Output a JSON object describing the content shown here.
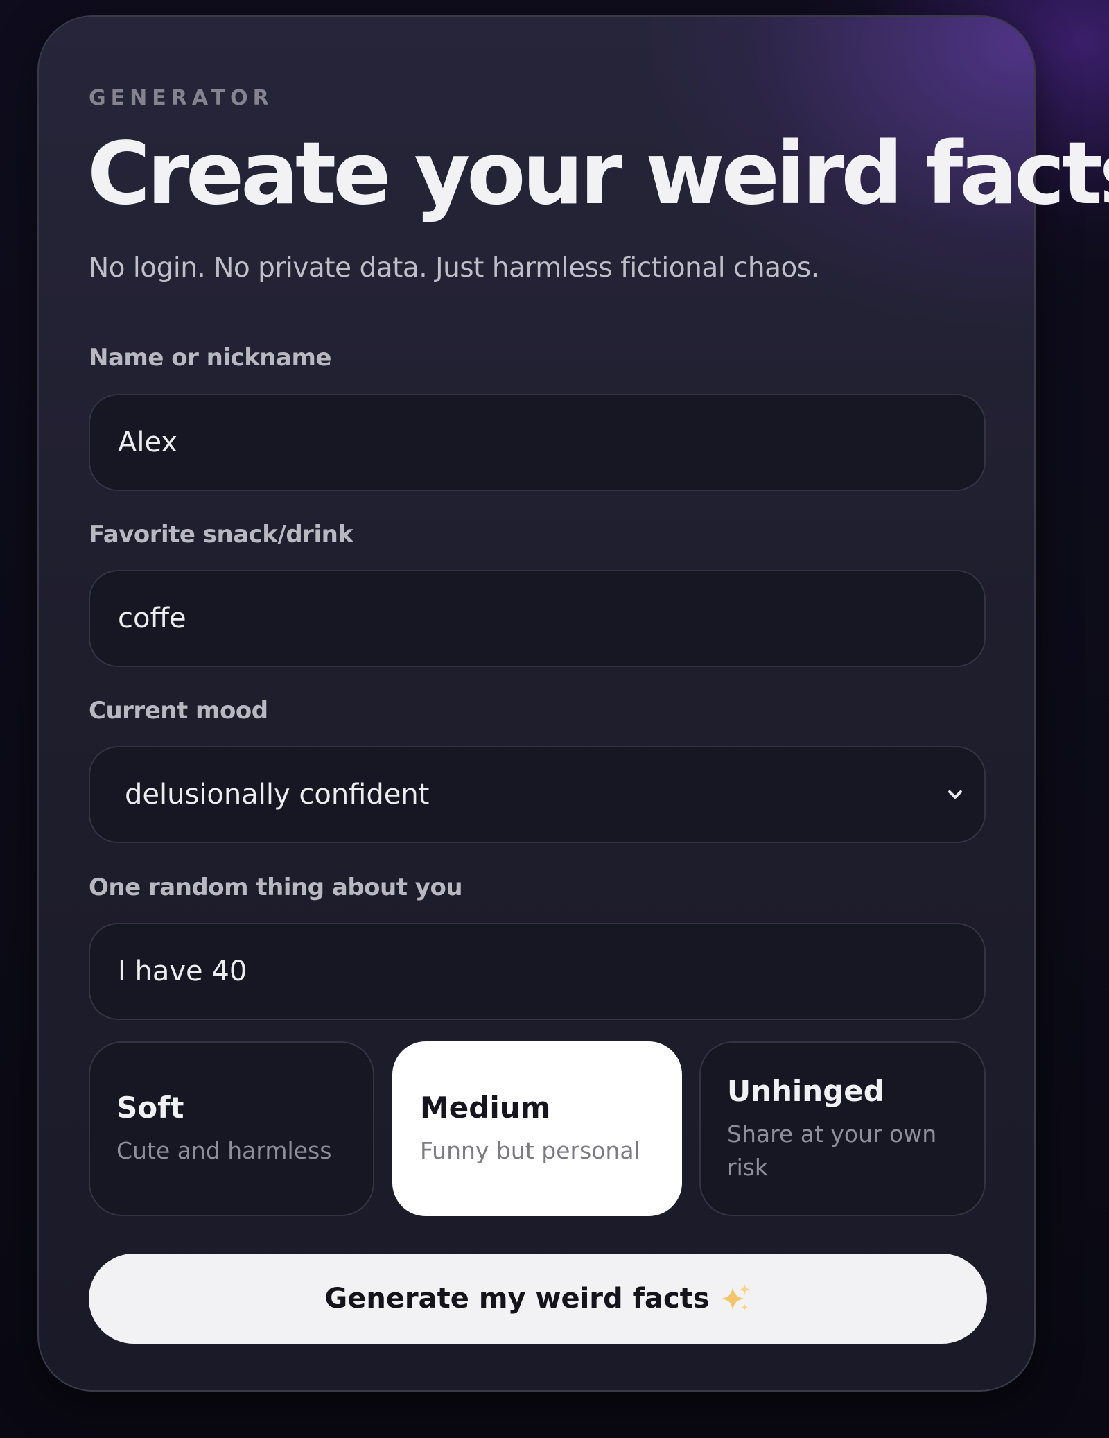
{
  "header": {
    "eyebrow": "GENERATOR",
    "title": "Create your weird facts",
    "subtitle": "No login. No private data. Just harmless fictional chaos."
  },
  "form": {
    "name": {
      "label": "Name or nickname",
      "value": "Alex"
    },
    "snack": {
      "label": "Favorite snack/drink",
      "value": "coffe"
    },
    "mood": {
      "label": "Current mood",
      "value": "delusionally confident"
    },
    "random": {
      "label": "One random thing about you",
      "value": "I have 40"
    }
  },
  "tones": [
    {
      "name": "Soft",
      "desc": "Cute and harmless",
      "selected": false
    },
    {
      "name": "Medium",
      "desc": "Funny but personal",
      "selected": true
    },
    {
      "name": "Unhinged",
      "desc": "Share at your own risk",
      "selected": false
    }
  ],
  "generate_button": {
    "label": "Generate my weird facts",
    "icon": "sparkles-icon"
  },
  "colors": {
    "card_bg": "#1f1e2d",
    "accent_glow": "#5c389e",
    "field_bg": "#171623",
    "selected_tone_bg": "#ffffff",
    "button_bg": "#f2f2f4",
    "sparkle": "#f5c46a"
  }
}
